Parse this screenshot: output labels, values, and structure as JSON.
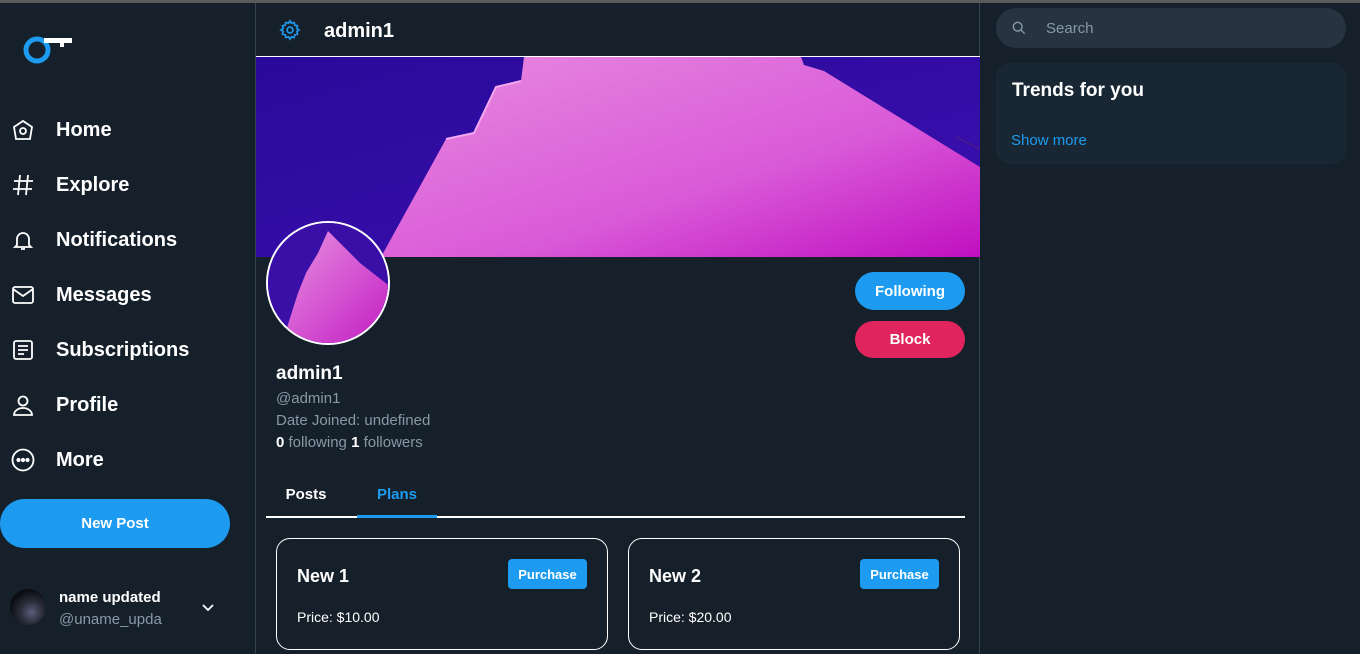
{
  "brand": {
    "accent": "#1d9bf0",
    "danger": "#e0245e",
    "background": "#15202b"
  },
  "sidebar": {
    "items": [
      {
        "label": "Home",
        "icon": "home-icon"
      },
      {
        "label": "Explore",
        "icon": "hashtag-icon"
      },
      {
        "label": "Notifications",
        "icon": "bell-icon"
      },
      {
        "label": "Messages",
        "icon": "mail-icon"
      },
      {
        "label": "Subscriptions",
        "icon": "document-icon"
      },
      {
        "label": "Profile",
        "icon": "user-icon"
      },
      {
        "label": "More",
        "icon": "more-icon"
      }
    ],
    "new_post_label": "New Post",
    "account": {
      "name": "name updated",
      "handle": "@uname_upda"
    }
  },
  "header": {
    "title": "admin1"
  },
  "profile": {
    "name": "admin1",
    "handle": "@admin1",
    "date_joined": "Date Joined: undefined",
    "following_count": "0",
    "following_label": "following",
    "followers_count": "1",
    "followers_label": "followers",
    "following_button": "Following",
    "block_button": "Block"
  },
  "tabs": [
    {
      "label": "Posts",
      "active": false
    },
    {
      "label": "Plans",
      "active": true
    }
  ],
  "plans": [
    {
      "title": "New 1",
      "price": "Price: $10.00",
      "button": "Purchase"
    },
    {
      "title": "New 2",
      "price": "Price: $20.00",
      "button": "Purchase"
    }
  ],
  "search": {
    "placeholder": "Search"
  },
  "trends": {
    "title": "Trends for you",
    "show_more": "Show more"
  }
}
